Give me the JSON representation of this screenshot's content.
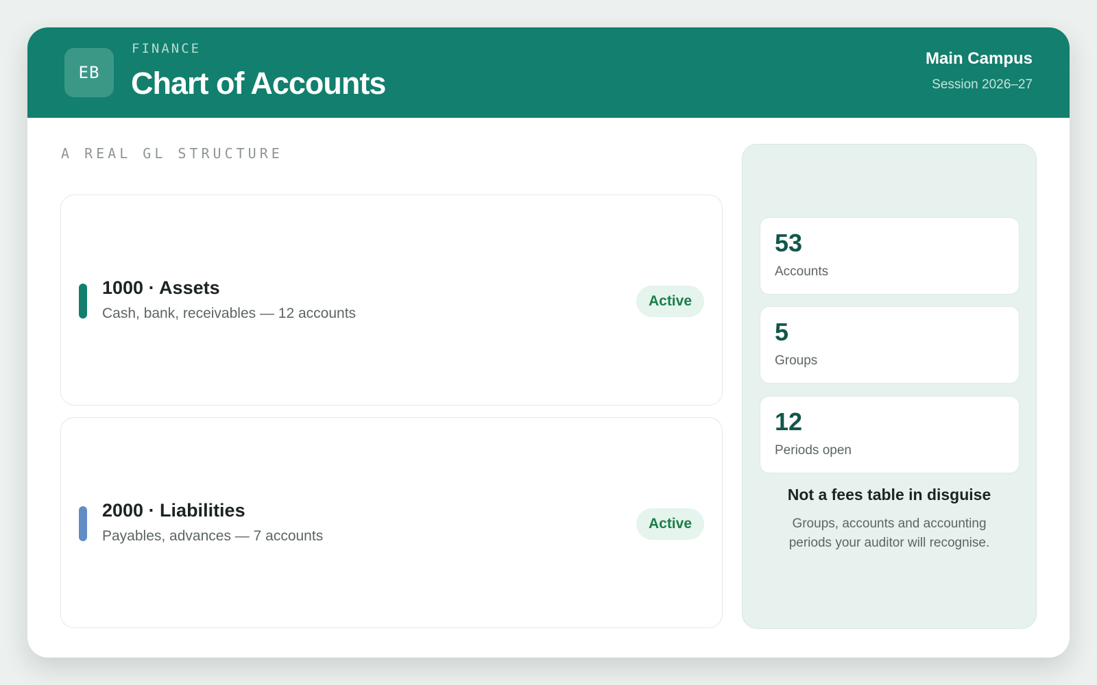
{
  "header": {
    "logo_initials": "EB",
    "eyebrow": "FINANCE",
    "title": "Chart of Accounts",
    "campus": "Main Campus",
    "session": "Session 2026–27",
    "color": "#137f6e"
  },
  "main": {
    "section_label": "A REAL GL STRUCTURE",
    "groups": [
      {
        "title": "1000 · Assets",
        "description": "Cash, bank, receivables — 12 accounts",
        "status": "Active",
        "accent_color": "#137f6e"
      },
      {
        "title": "2000 · Liabilities",
        "description": "Payables, advances — 7 accounts",
        "status": "Active",
        "accent_color": "#5e8ec4"
      }
    ]
  },
  "sidebar": {
    "stats": [
      {
        "value": "53",
        "label": "Accounts"
      },
      {
        "value": "5",
        "label": "Groups"
      },
      {
        "value": "12",
        "label": "Periods open"
      }
    ],
    "heading": "Not a fees table in disguise",
    "note": "Groups, accounts and accounting periods your auditor will recognise."
  }
}
